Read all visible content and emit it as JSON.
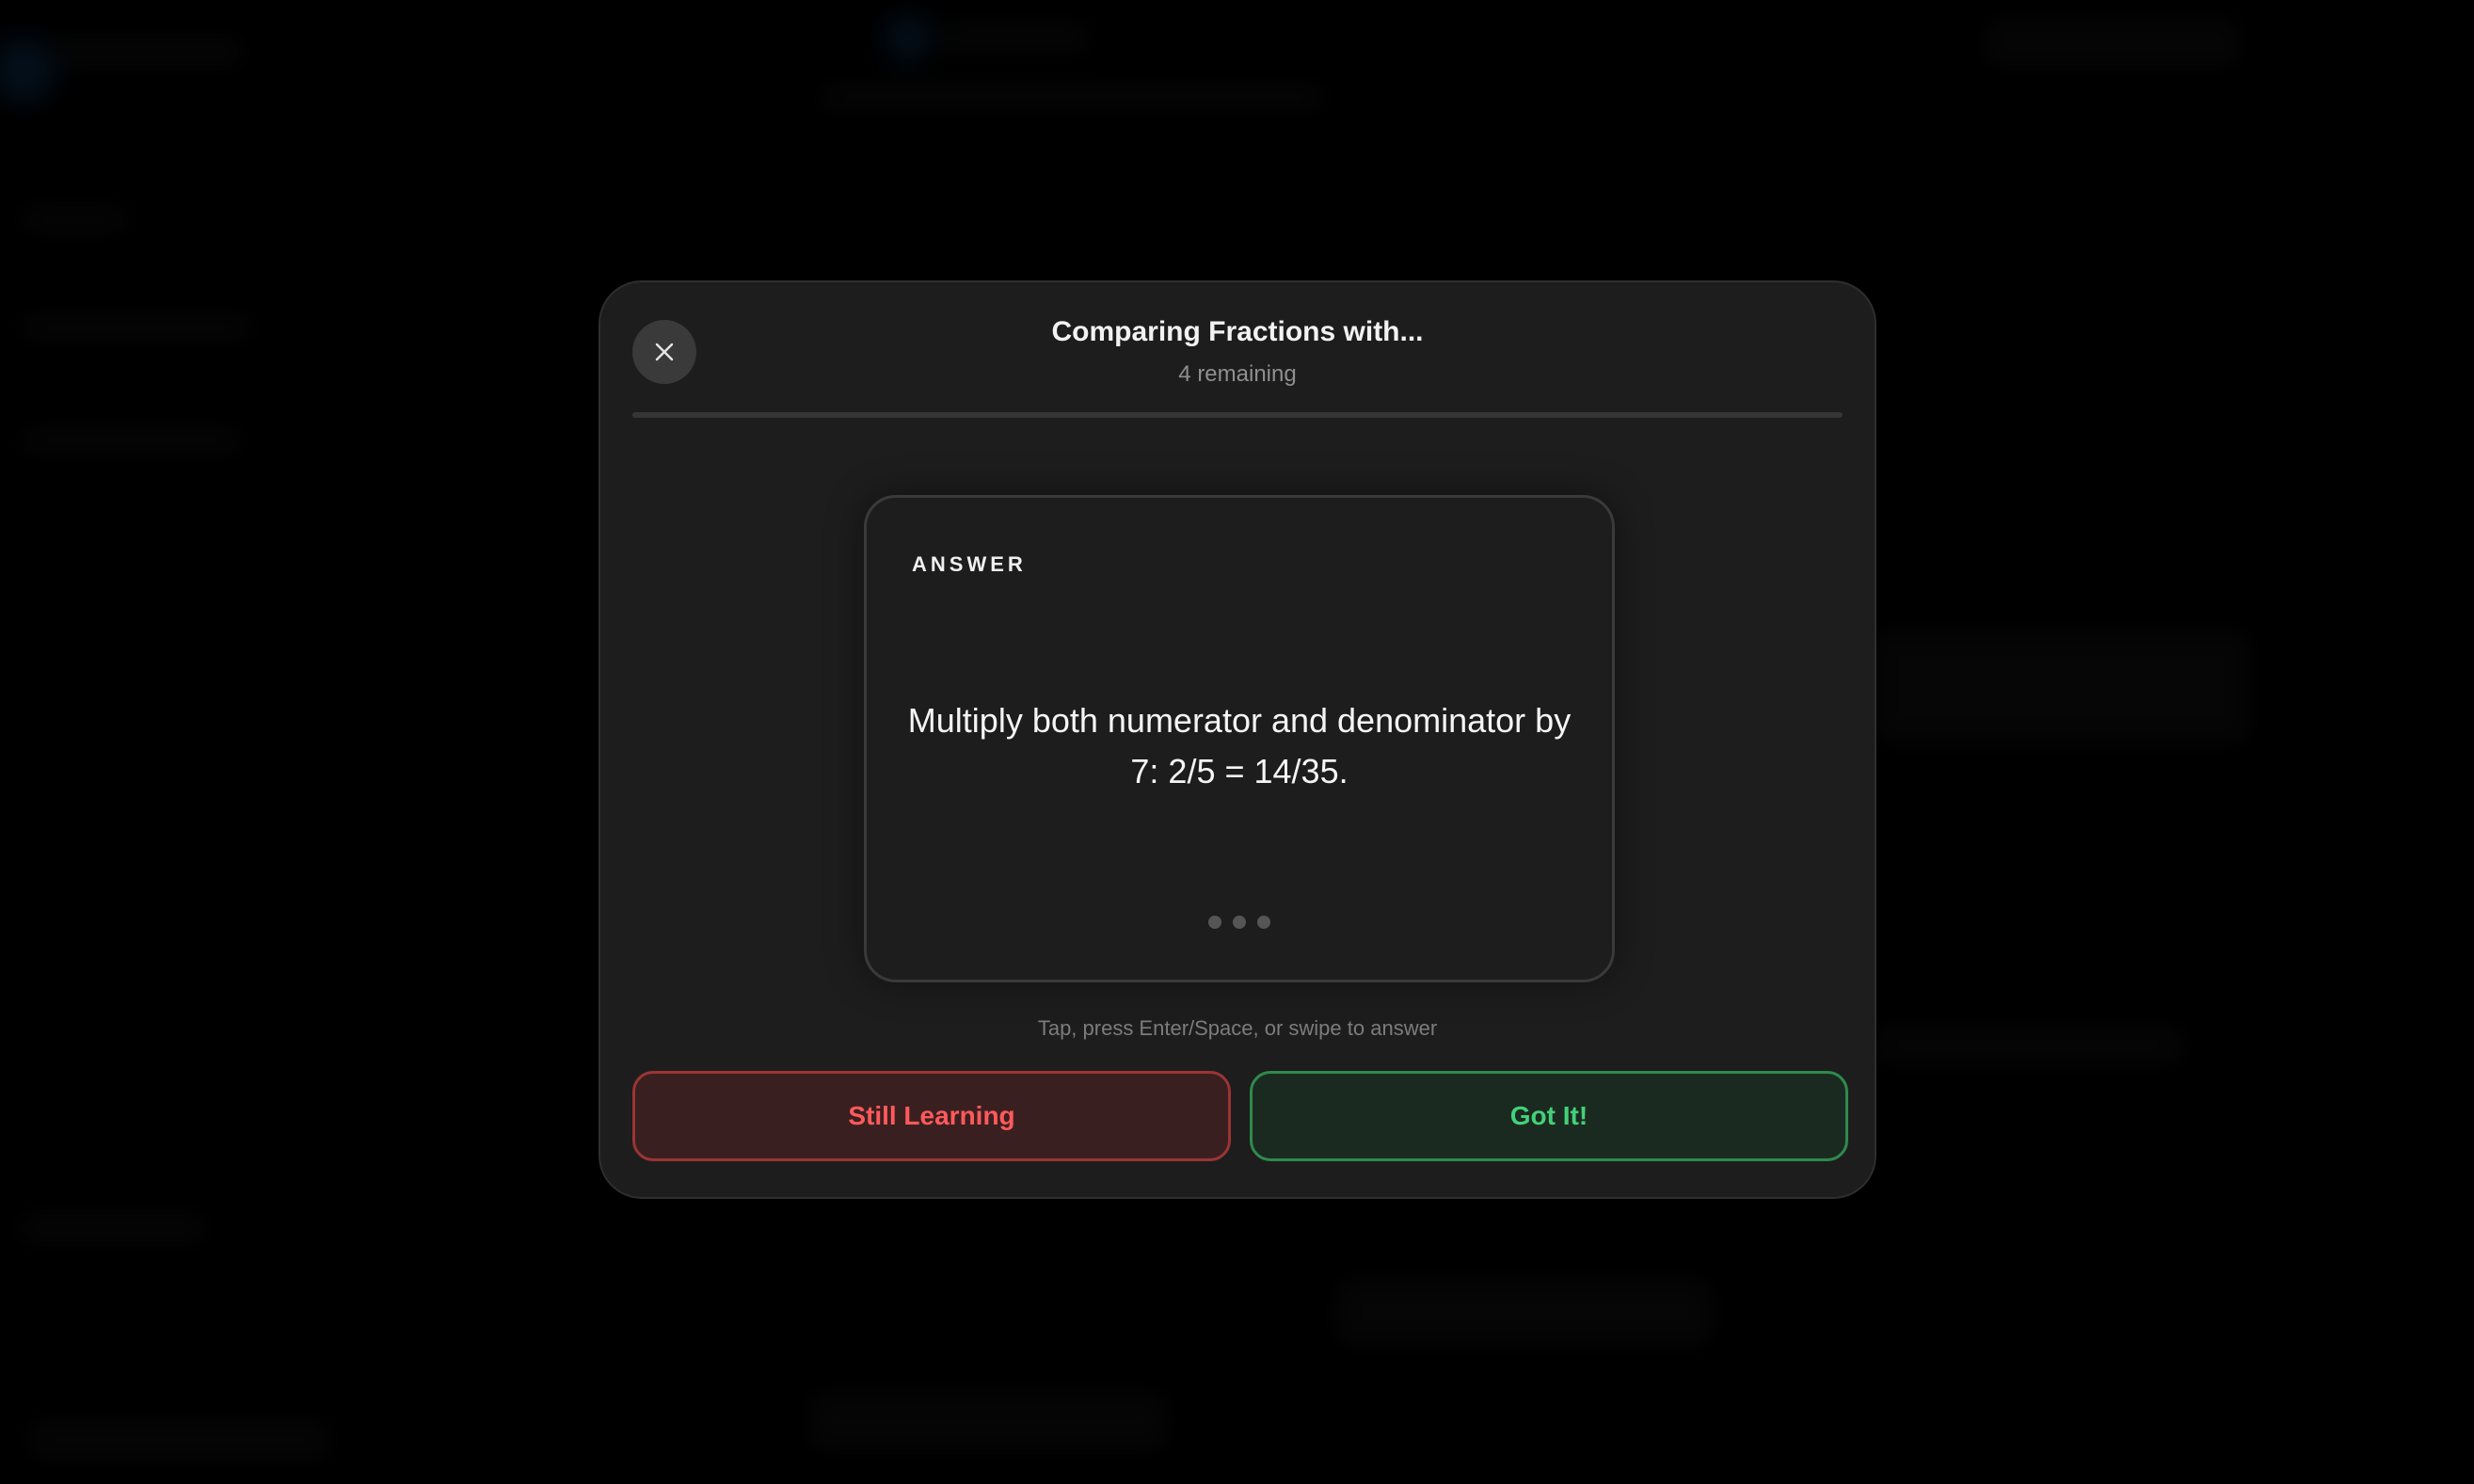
{
  "modal": {
    "title": "Comparing Fractions with...",
    "subtitle": "4 remaining",
    "progress_percent": 0
  },
  "card": {
    "label": "ANSWER",
    "text": "Multiply both numerator and denominator by 7: 2/5 = 14/35."
  },
  "hint": "Tap, press Enter/Space, or swipe to answer",
  "actions": {
    "still_learning": "Still Learning",
    "got_it": "Got It!"
  },
  "icons": {
    "close": "close-icon"
  },
  "colors": {
    "danger": "#ff5a5a",
    "success": "#44d07a"
  }
}
